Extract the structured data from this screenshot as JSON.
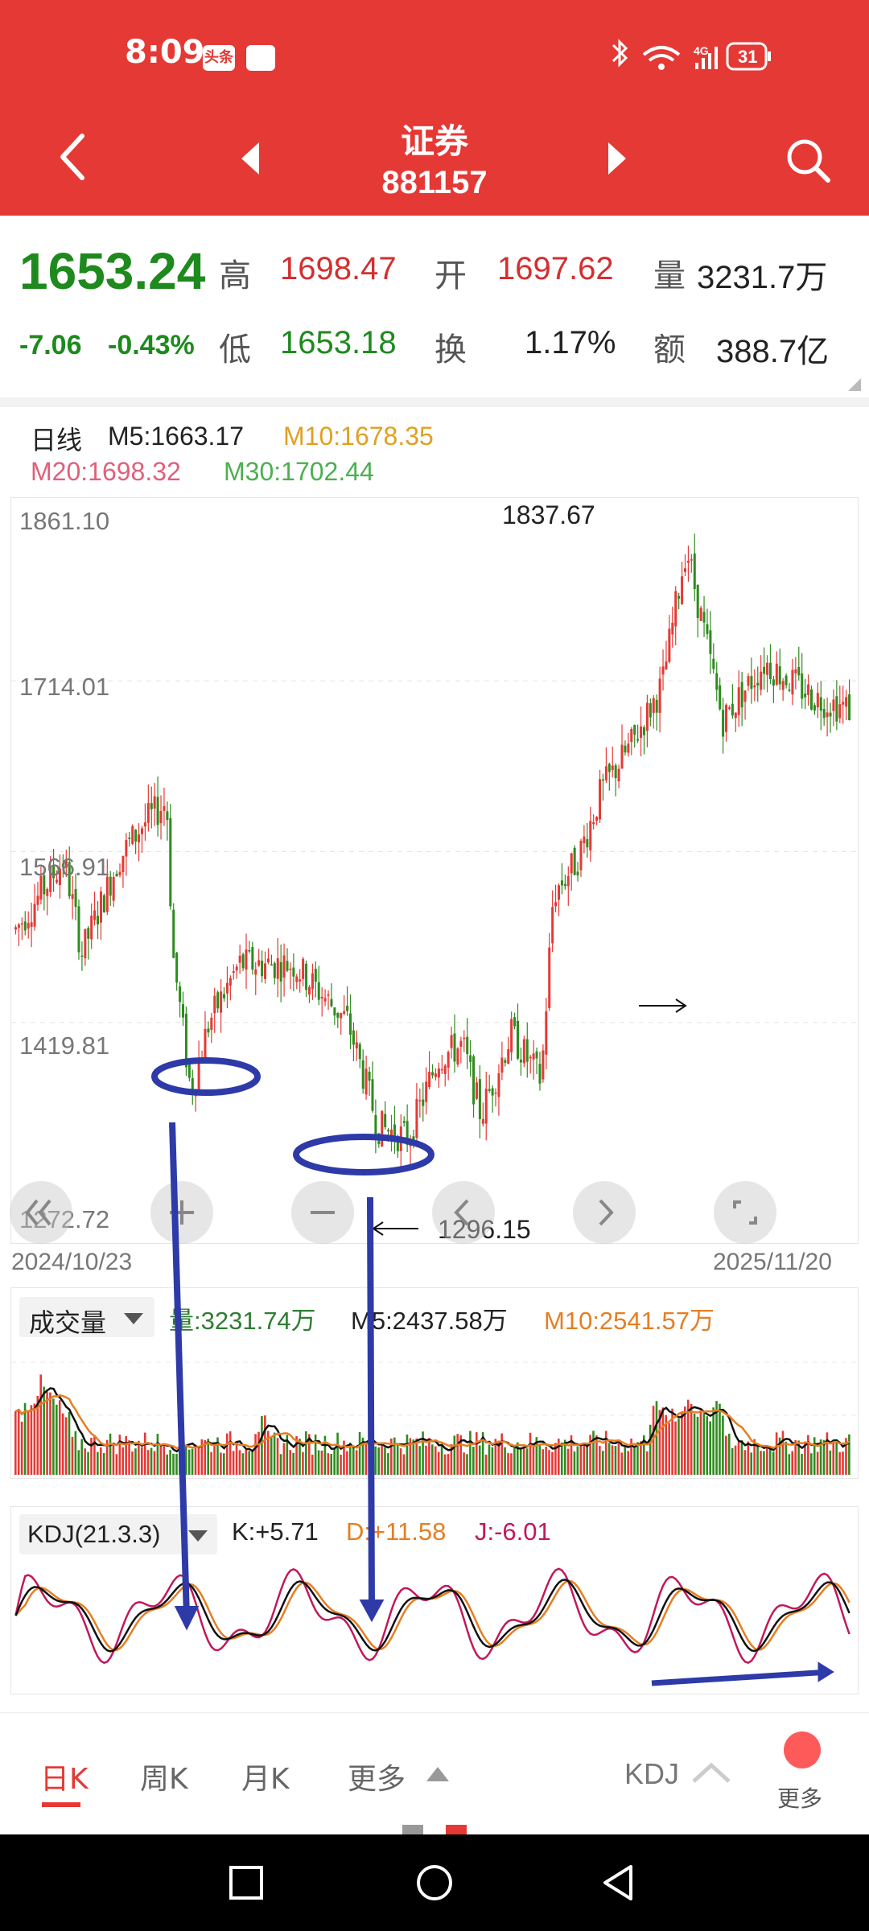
{
  "status_bar": {
    "time": "8:09",
    "app_badge_1": "头条",
    "battery": "31",
    "network": "4G"
  },
  "header": {
    "title": "证券",
    "code": "881157"
  },
  "quote": {
    "price": "1653.24",
    "change": "-7.06",
    "change_pct": "-0.43%",
    "high_label": "高",
    "high": "1698.47",
    "open_label": "开",
    "open": "1697.62",
    "volume_label": "量",
    "volume": "3231.7万",
    "low_label": "低",
    "low": "1653.18",
    "turnover_label": "换",
    "turnover": "1.17%",
    "amount_label": "额",
    "amount": "388.7亿"
  },
  "ma_legend": {
    "period": "日线",
    "m5": "M5:1663.17",
    "m10": "M10:1678.35",
    "m20": "M20:1698.32",
    "m30": "M30:1702.44"
  },
  "price_chart": {
    "y_ticks": [
      "1861.10",
      "1714.01",
      "1566.91",
      "1419.81",
      "1272.72"
    ],
    "max_label": "1837.67",
    "min_label": "1296.15",
    "start_date": "2024/10/23",
    "end_date": "2025/11/20"
  },
  "volume_panel": {
    "selector": "成交量",
    "vol": "量:3231.74万",
    "m5": "M5:2437.58万",
    "m10": "M10:2541.57万"
  },
  "kdj_panel": {
    "selector": "KDJ(21.3.3)",
    "k": "K:+5.71",
    "d": "D:+11.58",
    "j": "J:-6.01"
  },
  "bottom_tabs": {
    "tabs": [
      "日K",
      "周K",
      "月K",
      "更多"
    ],
    "indicator": "KDJ",
    "more": "更多"
  },
  "colors": {
    "header_red": "#e53935",
    "up_red": "#e53935",
    "down_green": "#2e8b1e",
    "annotation_blue": "#2d3aa8",
    "m10_orange": "#e0a020",
    "m20_pink": "#e0607a"
  },
  "icons": [
    "back-icon",
    "prev-icon",
    "next-icon",
    "search-icon",
    "zoom-out-icon",
    "zoom-in-icon",
    "minus-icon",
    "left-icon",
    "right-icon",
    "fullscreen-icon"
  ]
}
